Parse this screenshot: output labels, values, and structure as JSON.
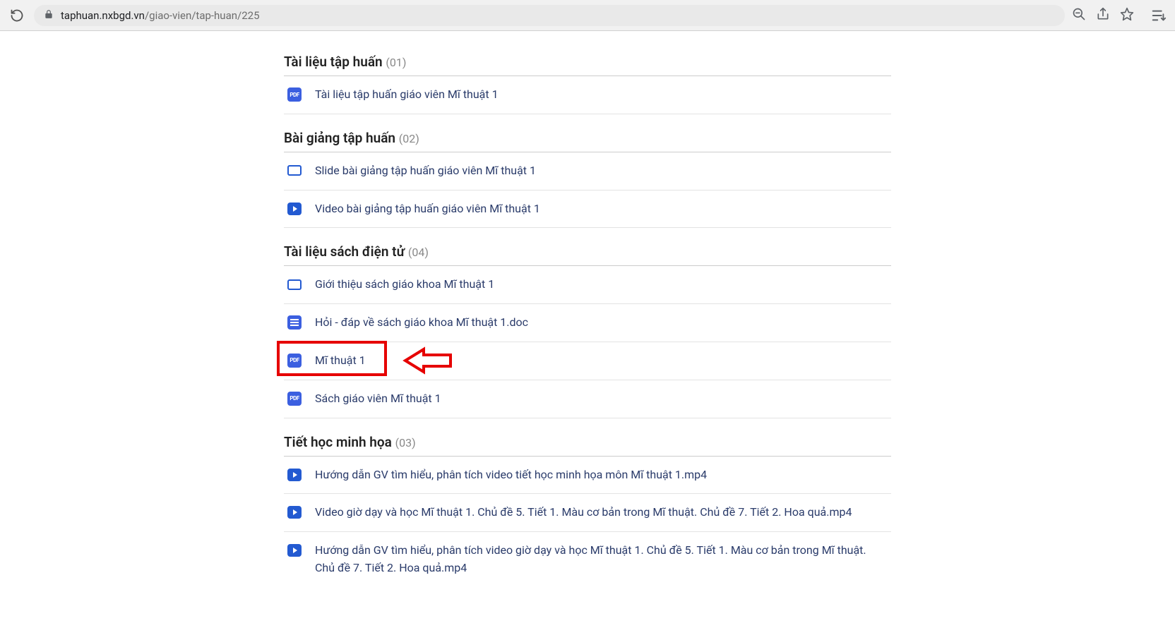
{
  "browser": {
    "url_host": "taphuan.nxbgd.vn",
    "url_path": "/giao-vien/tap-huan/225"
  },
  "sections": [
    {
      "title": "Tài liệu tập huấn",
      "count": "(01)",
      "items": [
        {
          "icon": "pdf",
          "label": "Tài liệu tập huấn giáo viên Mĩ thuật 1"
        }
      ]
    },
    {
      "title": "Bài giảng tập huấn",
      "count": "(02)",
      "items": [
        {
          "icon": "slide",
          "label": "Slide bài giảng tập huấn giáo viên Mĩ thuật 1"
        },
        {
          "icon": "video",
          "label": "Video bài giảng tập huấn giáo viên Mĩ thuật 1"
        }
      ]
    },
    {
      "title": "Tài liệu sách điện tử",
      "count": "(04)",
      "items": [
        {
          "icon": "slide",
          "label": "Giới thiệu sách giáo khoa Mĩ thuật 1"
        },
        {
          "icon": "doc",
          "label": "Hỏi - đáp về sách giáo khoa Mĩ thuật 1.doc"
        },
        {
          "icon": "pdf",
          "label": "Mĩ thuật 1",
          "highlighted": true
        },
        {
          "icon": "pdf",
          "label": "Sách giáo viên Mĩ thuật 1"
        }
      ]
    },
    {
      "title": "Tiết học minh họa",
      "count": "(03)",
      "items": [
        {
          "icon": "video",
          "label": "Hướng dẫn GV tìm hiểu, phân tích video tiết học minh họa môn Mĩ thuật 1.mp4"
        },
        {
          "icon": "video",
          "label": "Video giờ dạy và học Mĩ thuật 1. Chủ đề 5. Tiết 1. Màu cơ bản trong Mĩ thuật. Chủ đề 7. Tiết 2. Hoa quả.mp4"
        },
        {
          "icon": "video",
          "label": "Hướng dẫn GV tìm hiểu, phân tích video giờ dạy và học Mĩ thuật 1. Chủ đề 5. Tiết 1. Màu cơ bản trong Mĩ thuật. Chủ đề 7. Tiết 2. Hoa quả.mp4"
        }
      ]
    }
  ],
  "icon_labels": {
    "pdf": "PDF"
  }
}
